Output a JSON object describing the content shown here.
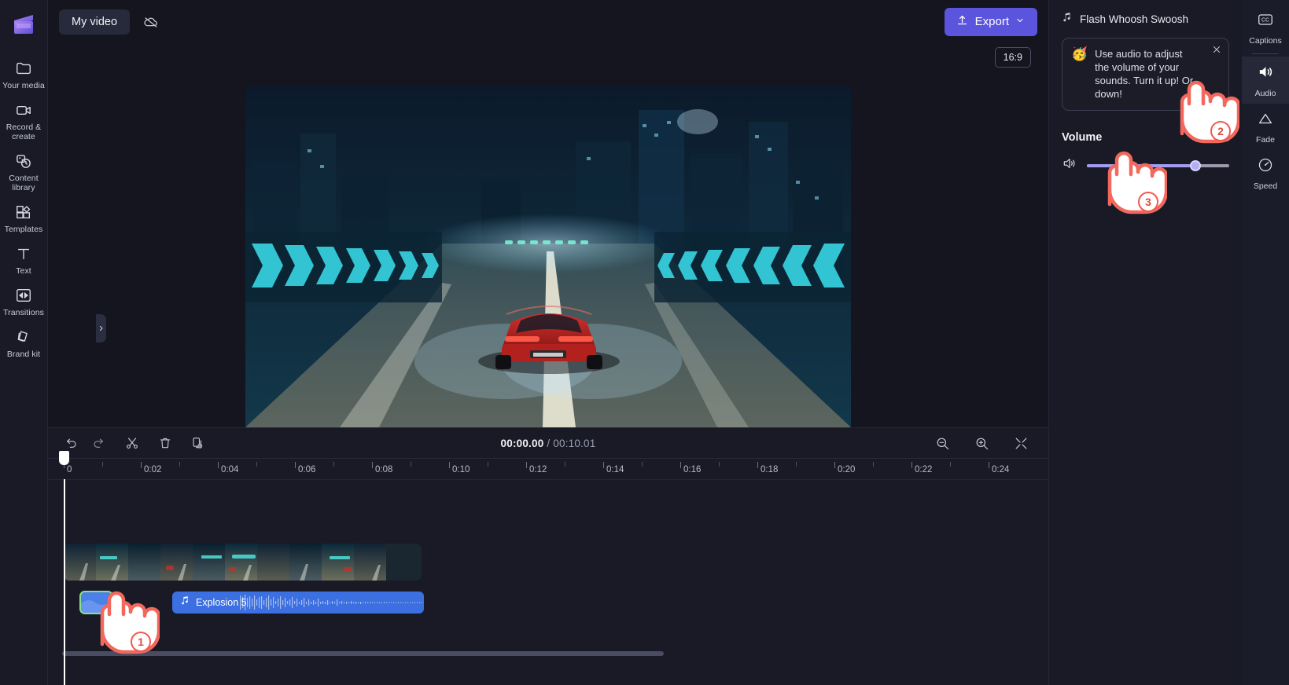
{
  "left_rail": {
    "logo": "clipchamp-logo",
    "items": [
      {
        "label": "Your media",
        "icon": "folder-icon"
      },
      {
        "label": "Record & create",
        "icon": "video-camera-icon"
      },
      {
        "label": "Content library",
        "icon": "shapes-icon"
      },
      {
        "label": "Templates",
        "icon": "templates-icon"
      },
      {
        "label": "Text",
        "icon": "text-icon"
      },
      {
        "label": "Transitions",
        "icon": "transitions-icon"
      },
      {
        "label": "Brand kit",
        "icon": "brand-kit-icon"
      }
    ]
  },
  "topbar": {
    "project_name": "My video",
    "cloud_icon": "cloud-off-icon",
    "export_label": "Export",
    "export_icon": "upload-icon",
    "export_chevron": "chevron-down-icon",
    "export_color": "#5b54dd"
  },
  "preview": {
    "aspect_ratio": "16:9",
    "captions_toggle_icon": "captions-off-icon",
    "skip_start_icon": "skip-to-start-icon",
    "rewind_icon": "rewind-5s-icon",
    "play_icon": "play-icon",
    "forward_icon": "forward-5s-icon",
    "skip_end_icon": "skip-to-end-icon",
    "fullscreen_icon": "fullscreen-icon",
    "help_label": "?",
    "collapse_chevron_icon": "chevron-down-icon",
    "left_handle_icon": "chevron-right-icon",
    "right_handle_icon": "chevron-right-icon"
  },
  "timeline": {
    "toolbar": {
      "undo_icon": "undo-icon",
      "redo_icon": "redo-icon",
      "split_icon": "scissors-icon",
      "delete_icon": "trash-icon",
      "duplicate_icon": "duplicate-icon",
      "zoom_out_icon": "zoom-out-icon",
      "zoom_in_icon": "zoom-in-icon",
      "fit_icon": "fit-to-screen-icon"
    },
    "current_time": "00:00.00",
    "separator": "/",
    "total_time": "00:10.01",
    "ruler_labels": [
      "0",
      "0:02",
      "0:04",
      "0:06",
      "0:08",
      "0:10",
      "0:12",
      "0:14",
      "0:16",
      "0:18",
      "0:20",
      "0:22",
      "0:24"
    ],
    "video_clip_name": "video-track-clip",
    "audio_clip_name": "Explosion 5",
    "audio_clip_icon": "music-note-icon",
    "selected_clip_name": "selected-audio-clip"
  },
  "right_panel": {
    "title": "Flash Whoosh Swoosh",
    "title_icon": "music-note-icon",
    "tip": {
      "emoji": "🥳",
      "text": "Use audio to adjust the volume of your sounds. Turn it up! Or down!",
      "close_icon": "close-icon"
    },
    "volume_label": "Volume",
    "volume_value": "153%",
    "volume_icon": "speaker-icon",
    "accent_color": "#a39cf0"
  },
  "right_rail": {
    "items": [
      {
        "label": "Captions",
        "icon": "cc-icon",
        "active": false
      },
      {
        "label": "Audio",
        "icon": "speaker-icon",
        "active": true
      },
      {
        "label": "Fade",
        "icon": "fade-icon",
        "active": false
      },
      {
        "label": "Speed",
        "icon": "speedometer-icon",
        "active": false
      }
    ]
  },
  "cursors": [
    {
      "badge": "1",
      "target": "selected-audio-clip"
    },
    {
      "badge": "2",
      "target": "right-rail-audio"
    },
    {
      "badge": "3",
      "target": "volume-slider-knob"
    }
  ]
}
